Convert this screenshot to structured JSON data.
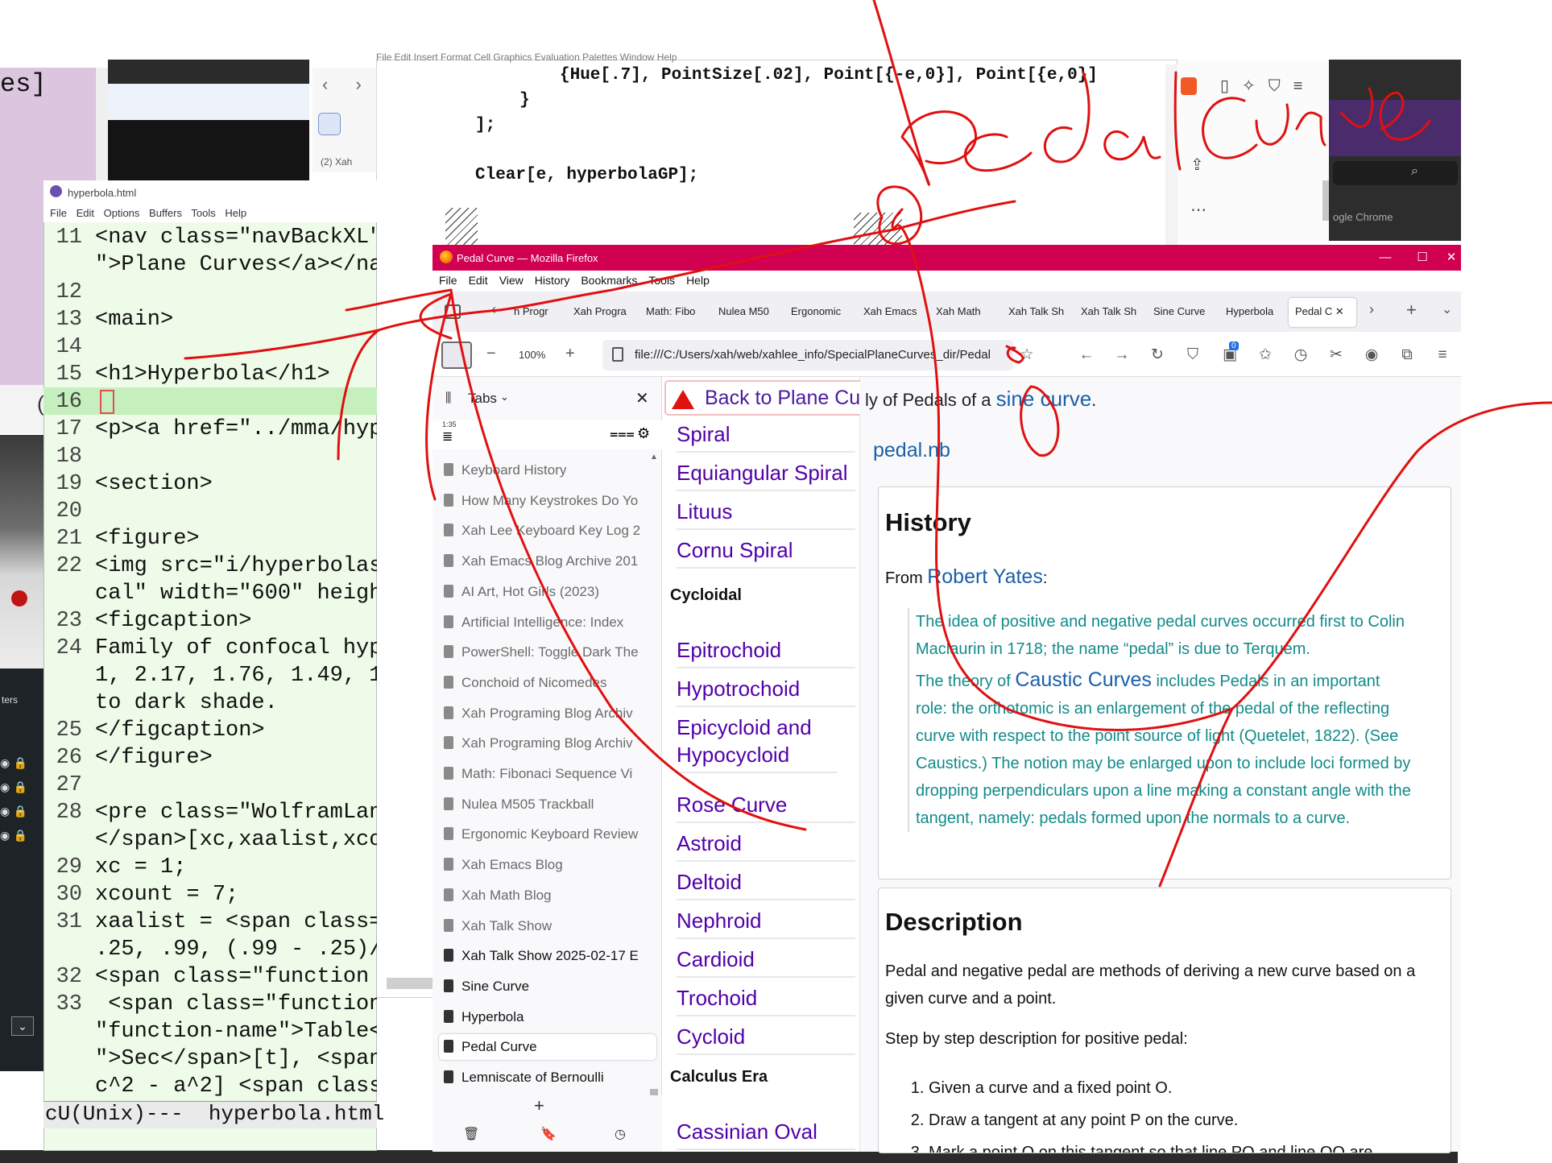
{
  "background": {
    "purple_window_text": "es]",
    "x_tab_label": "(2) Xah",
    "chrome_label": "ogle Chrome",
    "left_panel_text": "ters",
    "left_panel_char": "("
  },
  "notebook": {
    "menubar": "File   Edit   Insert   Format   Cell   Graphics   Evaluation   Palettes   Window   Help",
    "code_line_1": "{Hue[.7], PointSize[.02], Point[{-e,0}], Point[{e,0}]",
    "code_line_2": "}",
    "code_line_3": "];",
    "code_line_4": "Clear[e, hyperbolaGP];"
  },
  "emacs": {
    "title": "hyperbola.html",
    "menu": [
      "File",
      "Edit",
      "Options",
      "Buffers",
      "Tools",
      "Help"
    ],
    "lines": [
      {
        "n": "11",
        "t": "<nav class=\"navBackXL\""
      },
      {
        "n": "",
        "t": "\">Plane Curves</a></na"
      },
      {
        "n": "12",
        "t": ""
      },
      {
        "n": "13",
        "t": "<main>"
      },
      {
        "n": "14",
        "t": ""
      },
      {
        "n": "15",
        "t": "<h1>Hyperbola</h1>"
      },
      {
        "n": "16",
        "t": ""
      },
      {
        "n": "17",
        "t": "<p><a href=\"../mma/hyp"
      },
      {
        "n": "18",
        "t": ""
      },
      {
        "n": "19",
        "t": "<section>"
      },
      {
        "n": "20",
        "t": ""
      },
      {
        "n": "21",
        "t": "<figure>"
      },
      {
        "n": "22",
        "t": "<img src=\"i/hyperbolas"
      },
      {
        "n": "",
        "t": "cal\" width=\"600\" heigh"
      },
      {
        "n": "23",
        "t": "<figcaption>"
      },
      {
        "n": "24",
        "t": "Family of confocal hyp"
      },
      {
        "n": "",
        "t": "1, 2.17, 1.76, 1.49, 1"
      },
      {
        "n": "",
        "t": "to dark shade."
      },
      {
        "n": "25",
        "t": "</figcaption>"
      },
      {
        "n": "26",
        "t": "</figure>"
      },
      {
        "n": "27",
        "t": ""
      },
      {
        "n": "28",
        "t": "<pre class=\"WolframLan"
      },
      {
        "n": "",
        "t": "</span>[xc,xaalist,xco"
      },
      {
        "n": "29",
        "t": "xc = 1;"
      },
      {
        "n": "30",
        "t": "xcount = 7;"
      },
      {
        "n": "31",
        "t": "xaalist = <span class="
      },
      {
        "n": "",
        "t": ".25, .99, (.99 - .25)/"
      },
      {
        "n": "32",
        "t": "<span class=\"function"
      },
      {
        "n": "33",
        "t": " <span class=\"function-nam"
      },
      {
        "n": "",
        "t": "\"function-name\">Table</spa"
      },
      {
        "n": "",
        "t": "\">Sec</span>[t], <span cla"
      },
      {
        "n": "",
        "t": "c^2 - a^2] <span class=\"fu"
      }
    ],
    "modeline": "cU(Unix)---  hyperbola.html"
  },
  "firefox": {
    "title": "Pedal Curve — Mozilla Firefox",
    "menu": [
      "File",
      "Edit",
      "View",
      "History",
      "Bookmarks",
      "Tools",
      "Help"
    ],
    "tabs": [
      "h Progr",
      "Xah Progra",
      "Math: Fibo",
      "Nulea M50",
      "Ergonomic",
      "Xah Emacs",
      "Xah Math",
      "Xah Talk Sh",
      "Xah Talk Sh",
      "Sine Curve",
      "Hyperbola",
      "Pedal C"
    ],
    "zoom": "100%",
    "url": "file:///C:/Users/xah/web/xahlee_info/SpecialPlaneCurves_dir/Pedal",
    "badge_count": "0",
    "sidebar": {
      "title": "Tabs",
      "time_label": "1:35",
      "items": [
        {
          "label": "Keyboard History",
          "open": false
        },
        {
          "label": "How Many Keystrokes Do Yo",
          "open": false
        },
        {
          "label": "Xah Lee Keyboard Key Log 2",
          "open": false
        },
        {
          "label": "Xah Emacs Blog Archive 201",
          "open": false
        },
        {
          "label": "AI Art, Hot Girls (2023)",
          "open": false
        },
        {
          "label": "Artificial Intelligence: Index",
          "open": false
        },
        {
          "label": "PowerShell: Toggle Dark The",
          "open": false
        },
        {
          "label": "Conchoid of Nicomedes",
          "open": false
        },
        {
          "label": "Xah Programing Blog Archiv",
          "open": false
        },
        {
          "label": "Xah Programing Blog Archiv",
          "open": false
        },
        {
          "label": "Math: Fibonaci Sequence Vi",
          "open": false
        },
        {
          "label": "Nulea M505 Trackball",
          "open": false
        },
        {
          "label": "Ergonomic Keyboard Review",
          "open": false
        },
        {
          "label": "Xah Emacs Blog",
          "open": false
        },
        {
          "label": "Xah Math Blog",
          "open": false
        },
        {
          "label": "Xah Talk Show",
          "open": false
        },
        {
          "label": "Xah Talk Show 2025-02-17 E",
          "open": true
        },
        {
          "label": "Sine Curve",
          "open": true
        },
        {
          "label": "Hyperbola",
          "open": true
        },
        {
          "label": "Pedal Curve",
          "open": true,
          "selected": true
        },
        {
          "label": "Lemniscate of Bernoulli",
          "open": true
        }
      ]
    }
  },
  "page": {
    "back_link": "Back to Plane Curves",
    "nav_links_top": [
      "Spiral",
      "Equiangular Spiral",
      "Lituus",
      "Cornu Spiral"
    ],
    "section_cycloidal": "Cycloidal",
    "nav_links_cycloidal": [
      "Epitrochoid",
      "Hypotrochoid",
      "Epicycloid and Hypocycloid",
      "Rose Curve",
      "Astroid",
      "Deltoid",
      "Nephroid",
      "Cardioid",
      "Trochoid",
      "Cycloid"
    ],
    "section_calculus": "Calculus Era",
    "nav_links_calculus": [
      "Cassinian Oval"
    ],
    "intro_prefix": "ly of Pedals of a ",
    "intro_link": "sine curve",
    "intro_suffix": ".",
    "pedal_nb": "pedal.nb",
    "history": {
      "heading": "History",
      "from_prefix": "From ",
      "from_link": "Robert Yates",
      "from_suffix": ":",
      "quote_1": "The idea of positive and negative pedal curves occurred first to Colin Maclaurin in 1718; the name “pedal” is due to Terquem.",
      "quote_2_prefix": "The theory of ",
      "quote_2_link": "Caustic Curves",
      "quote_2_rest": " includes Pedals in an important role: the orthotomic is an enlargement of the pedal of the reflecting curve with respect to the point source of light (Quetelet, 1822). (See Caustics.) The notion may be enlarged upon to include loci formed by dropping perpendiculars upon a line making a constant angle with the tangent, namely: pedals formed upon the normals to a curve."
    },
    "description": {
      "heading": "Description",
      "p1": "Pedal and negative pedal are methods of deriving a new curve based on a given curve and a point.",
      "p2": "Step by step description for positive pedal:",
      "steps": [
        "Given a curve and a fixed point O.",
        "Draw a tangent at any point P on the curve.",
        "Mark a point Q on this tangent so that line PQ and line OQ are"
      ]
    }
  },
  "colors": {
    "firefox_title": "#d10050",
    "ink": "#e01010",
    "link": "#5200a8",
    "quote": "#138a8a"
  }
}
